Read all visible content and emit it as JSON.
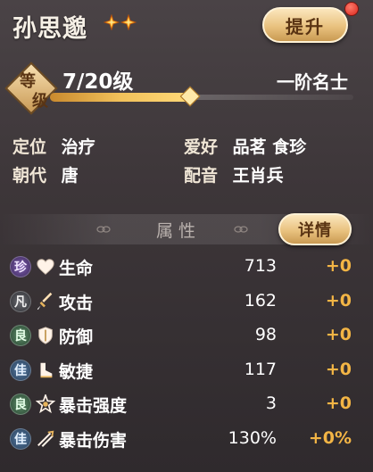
{
  "hero": {
    "name": "孙思邈",
    "star_count": 2,
    "level": "7/20级",
    "level_progress": 0.46,
    "rank": "一阶名士",
    "badge_top": "等",
    "badge_bottom": "级"
  },
  "upgrade_button": {
    "label": "提升",
    "has_notification": true
  },
  "info": {
    "role_label": "定位",
    "role_value": "治疗",
    "hobby_label": "爱好",
    "hobby_value": "品茗 食珍",
    "dynasty_label": "朝代",
    "dynasty_value": "唐",
    "voice_label": "配音",
    "voice_value": "王肖兵"
  },
  "attributes": {
    "section_title": "属性",
    "detail_button_label": "详情",
    "rows": [
      {
        "grade": "珍",
        "grade_class": "zhen",
        "icon": "heart-icon",
        "name": "生命",
        "value": "713",
        "bonus": "+0"
      },
      {
        "grade": "凡",
        "grade_class": "fan",
        "icon": "sword-icon",
        "name": "攻击",
        "value": "162",
        "bonus": "+0"
      },
      {
        "grade": "良",
        "grade_class": "liang",
        "icon": "shield-icon",
        "name": "防御",
        "value": "98",
        "bonus": "+0"
      },
      {
        "grade": "佳",
        "grade_class": "jia",
        "icon": "boot-icon",
        "name": "敏捷",
        "value": "117",
        "bonus": "+0"
      },
      {
        "grade": "良",
        "grade_class": "liang",
        "icon": "crit-star-icon",
        "name": "暴击强度",
        "value": "3",
        "bonus": "+0"
      },
      {
        "grade": "佳",
        "grade_class": "jia",
        "icon": "crit-slash-icon",
        "name": "暴击伤害",
        "value": "130%",
        "bonus": "+0%"
      }
    ]
  },
  "colors": {
    "accent_gold": "#f3b545",
    "button_gold": "#e9c27f",
    "notification_red": "#d8261c"
  }
}
